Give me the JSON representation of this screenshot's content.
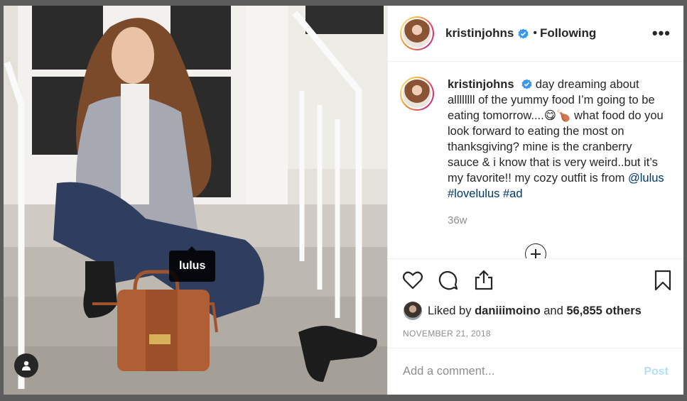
{
  "post": {
    "photo": {
      "tag_label": "lulus",
      "user_tag_icon": "person-icon"
    },
    "header": {
      "username": "kristinjohns",
      "verified_icon": "verified-badge-icon",
      "separator": "•",
      "follow_status": "Following",
      "more_icon": "more-options-icon",
      "more_glyph": "•••"
    },
    "caption": {
      "username": "kristinjohns",
      "text_part1": "day dreaming about allllllll of the yummy food I’m going to be eating tomorrow....😋🍗 what food do you look forward to eating the most on thanksgiving? mine is the cranberry sauce & i know that is very weird..but it’s my favorite!! my cozy outfit is from ",
      "mention": "@lulus",
      "hashtag1": "#lovelulus",
      "hashtag2": "#ad",
      "time": "36w"
    },
    "actions": {
      "like_icon": "heart-icon",
      "comment_icon": "comment-icon",
      "share_icon": "share-icon",
      "save_icon": "bookmark-icon",
      "load_more_icon": "plus-circle-icon"
    },
    "likes": {
      "prefix": "Liked by",
      "user": "daniiimoino",
      "middle": "and",
      "count": "56,855 others"
    },
    "date": "NOVEMBER 21, 2018",
    "comment_box": {
      "placeholder": "Add a comment...",
      "post_label": "Post"
    }
  },
  "colors": {
    "text": "#262626",
    "muted": "#8e8e8e",
    "link": "#00376b",
    "verified": "#3897f0",
    "post_disabled": "#b2dffc"
  }
}
